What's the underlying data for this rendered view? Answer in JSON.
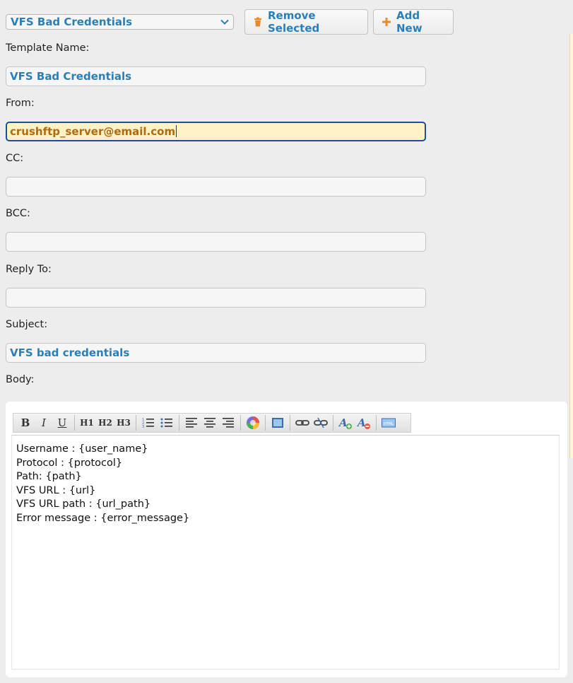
{
  "template_select": {
    "value": "VFS Bad Credentials"
  },
  "buttons": {
    "remove_selected": "Remove Selected",
    "add_new": "Add New"
  },
  "fields": {
    "template_name": {
      "label": "Template Name:",
      "value": "VFS Bad Credentials"
    },
    "from": {
      "label": "From:",
      "value": "crushftp_server@email.com"
    },
    "cc": {
      "label": "CC:",
      "value": ""
    },
    "bcc": {
      "label": "BCC:",
      "value": ""
    },
    "reply_to": {
      "label": "Reply To:",
      "value": ""
    },
    "subject": {
      "label": "Subject:",
      "value": "VFS bad credentials"
    }
  },
  "body": {
    "label": "Body:",
    "lines": [
      "Username : {user_name}",
      "Protocol : {protocol}",
      "Path: {path}",
      "VFS URL : {url}",
      "VFS URL path : {url_path}",
      "Error message : {error_message}"
    ]
  },
  "toolbar": {
    "bold": "B",
    "italic": "I",
    "underline": "U",
    "h1": "H1",
    "h2": "H2",
    "h3": "H3",
    "html": "HTML"
  },
  "colors": {
    "accent": "#2a7fb8",
    "active_field_bg": "#fdf3c6",
    "active_field_border": "#1d4e9c"
  }
}
